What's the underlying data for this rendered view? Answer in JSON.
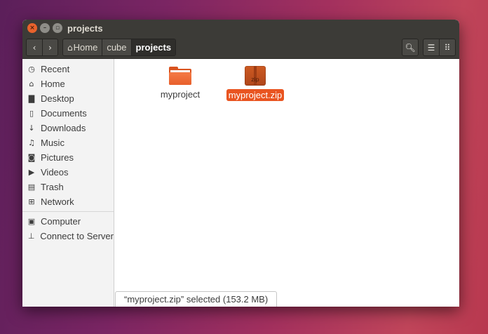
{
  "window": {
    "title": "projects",
    "close_glyph": "×",
    "minimize_glyph": "–",
    "maximize_glyph": "▫"
  },
  "toolbar": {
    "back_glyph": "‹",
    "forward_glyph": "›",
    "breadcrumbs": [
      {
        "label": "Home",
        "icon": "home-icon",
        "icon_glyph": "⌂"
      },
      {
        "label": "cube"
      },
      {
        "label": "projects",
        "active": true
      }
    ],
    "search_glyph": "🔍︎",
    "list_view_glyph": "☰",
    "grid_view_glyph": "⠿"
  },
  "sidebar": {
    "places": [
      {
        "label": "Recent",
        "icon": "clock-icon",
        "glyph": "◷"
      },
      {
        "label": "Home",
        "icon": "home-icon",
        "glyph": "⌂"
      },
      {
        "label": "Desktop",
        "icon": "folder-icon",
        "glyph": "▇"
      },
      {
        "label": "Documents",
        "icon": "document-icon",
        "glyph": "▯"
      },
      {
        "label": "Downloads",
        "icon": "download-icon",
        "glyph": "↓"
      },
      {
        "label": "Music",
        "icon": "music-icon",
        "glyph": "♫"
      },
      {
        "label": "Pictures",
        "icon": "camera-icon",
        "glyph": "◙"
      },
      {
        "label": "Videos",
        "icon": "video-icon",
        "glyph": "▶"
      },
      {
        "label": "Trash",
        "icon": "trash-icon",
        "glyph": "▤"
      },
      {
        "label": "Network",
        "icon": "network-icon",
        "glyph": "⊞"
      }
    ],
    "devices": [
      {
        "label": "Computer",
        "icon": "computer-icon",
        "glyph": "▣"
      },
      {
        "label": "Connect to Server",
        "icon": "server-icon",
        "glyph": "⊥"
      }
    ]
  },
  "files": [
    {
      "name": "myproject",
      "type": "folder",
      "selected": false
    },
    {
      "name": "myproject.zip",
      "type": "zip",
      "icon_text": "zip",
      "selected": true
    }
  ],
  "status": {
    "text": "“myproject.zip” selected  (153.2 MB)"
  },
  "colors": {
    "accent": "#e95420",
    "titlebar": "#3c3b37",
    "sidebar_bg": "#f3f3f3"
  }
}
